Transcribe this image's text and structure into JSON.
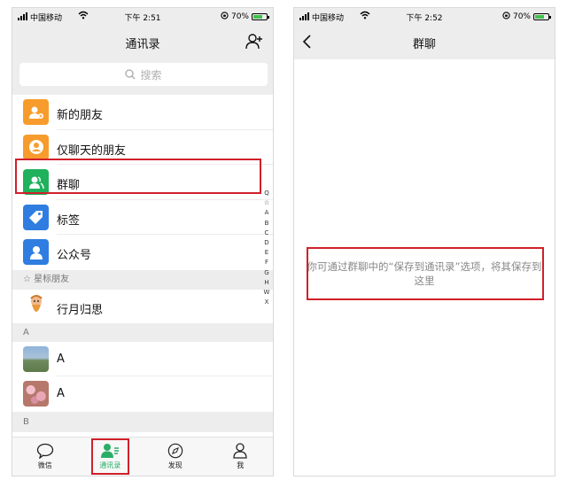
{
  "left": {
    "status": {
      "carrier": "中国移动",
      "time": "下午 2:51",
      "battery": "70%",
      "battery_level": 0.7
    },
    "nav": {
      "title": "通讯录"
    },
    "search": {
      "placeholder": "搜索"
    },
    "menu": [
      {
        "label": "新的朋友",
        "icon": "add-friend-icon",
        "color": "#f79c2c"
      },
      {
        "label": "仅聊天的朋友",
        "icon": "person-circle-icon",
        "color": "#f79c2c"
      },
      {
        "label": "群聊",
        "icon": "group-icon",
        "color": "#1fb15c"
      },
      {
        "label": "标签",
        "icon": "tag-icon",
        "color": "#2f7de1"
      },
      {
        "label": "公众号",
        "icon": "person-icon",
        "color": "#2f7de1"
      }
    ],
    "starred_header": "星标朋友",
    "starred": [
      {
        "label": "行月归思"
      }
    ],
    "sections": [
      {
        "letter": "A",
        "contacts": [
          {
            "label": "A"
          },
          {
            "label": "A"
          }
        ]
      },
      {
        "letter": "B",
        "contacts": []
      }
    ],
    "index": [
      "Q",
      "☆",
      "A",
      "B",
      "C",
      "D",
      "E",
      "F",
      "G",
      "H",
      "W",
      "X"
    ],
    "tabs": [
      {
        "label": "微信",
        "icon": "chat-bubble-icon",
        "active": false
      },
      {
        "label": "通讯录",
        "icon": "contacts-icon",
        "active": true
      },
      {
        "label": "发现",
        "icon": "compass-icon",
        "active": false
      },
      {
        "label": "我",
        "icon": "me-icon",
        "active": false
      }
    ]
  },
  "right": {
    "status": {
      "carrier": "中国移动",
      "time": "下午 2:52",
      "battery": "70%",
      "battery_level": 0.7
    },
    "nav": {
      "title": "群聊"
    },
    "empty_message": "你可通过群聊中的“保存到通讯录”选项，将其保存到这里"
  },
  "colors": {
    "accent_green": "#2aae67",
    "highlight_red": "#d0202a"
  }
}
